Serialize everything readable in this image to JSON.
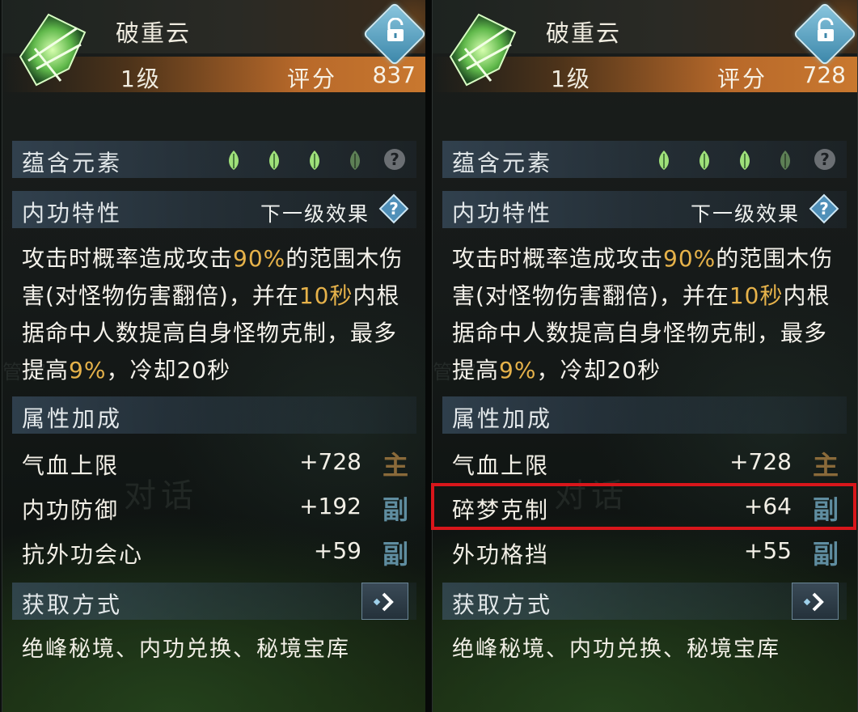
{
  "panels": [
    {
      "skill_name": "破重云",
      "level": "1级",
      "score_label": "评分",
      "score_value": "837",
      "elements_label": "蕴含元素",
      "elements_help": "?",
      "trait_label": "内功特性",
      "next_level_label": "下一级效果",
      "description": {
        "p1": "攻击时概率造成攻击",
        "h1": "90%",
        "p2": "的范围木伤害(对怪物伤害翻倍)，并在",
        "h2": "10秒",
        "p3": "内根据命中人数提高自身怪物克制，最多提高",
        "h3": "9%",
        "p4": "，冷却20秒"
      },
      "attr_label": "属性加成",
      "attributes": [
        {
          "name": "气血上限",
          "value": "+728",
          "tag": "主"
        },
        {
          "name": "内功防御",
          "value": "+192",
          "tag": "副"
        },
        {
          "name": "抗外功会心",
          "value": "+59",
          "tag": "副"
        }
      ],
      "source_label": "获取方式",
      "source_text": "绝峰秘境、内功兑换、秘境宝库"
    },
    {
      "skill_name": "破重云",
      "level": "1级",
      "score_label": "评分",
      "score_value": "728",
      "elements_label": "蕴含元素",
      "elements_help": "?",
      "trait_label": "内功特性",
      "next_level_label": "下一级效果",
      "description": {
        "p1": "攻击时概率造成攻击",
        "h1": "90%",
        "p2": "的范围木伤害(对怪物伤害翻倍)，并在",
        "h2": "10秒",
        "p3": "内根据命中人数提高自身怪物克制，最多提高",
        "h3": "9%",
        "p4": "，冷却20秒"
      },
      "attr_label": "属性加成",
      "attributes": [
        {
          "name": "气血上限",
          "value": "+728",
          "tag": "主"
        },
        {
          "name": "碎梦克制",
          "value": "+64",
          "tag": "副"
        },
        {
          "name": "外功格挡",
          "value": "+55",
          "tag": "副"
        }
      ],
      "source_label": "获取方式",
      "source_text": "绝峰秘境、内功兑换、秘境宝库"
    }
  ],
  "background_text": {
    "dialog": "对话",
    "steward": "管家"
  },
  "colors": {
    "highlight_text": "#e6b24a",
    "level_bar": "#c9782f",
    "red_highlight_box": "#d8161b",
    "leaf_active": "#9fe07a",
    "leaf_inactive": "#5d7f55",
    "tag_main": "#8a6a3a",
    "tag_sub": "#5f8da0"
  },
  "icons": {
    "skill": "green-leaf-skill-icon",
    "lock": "unlock-icon",
    "element": "leaf-icon",
    "help": "question-icon",
    "arrow": "chevron-right-icon"
  }
}
